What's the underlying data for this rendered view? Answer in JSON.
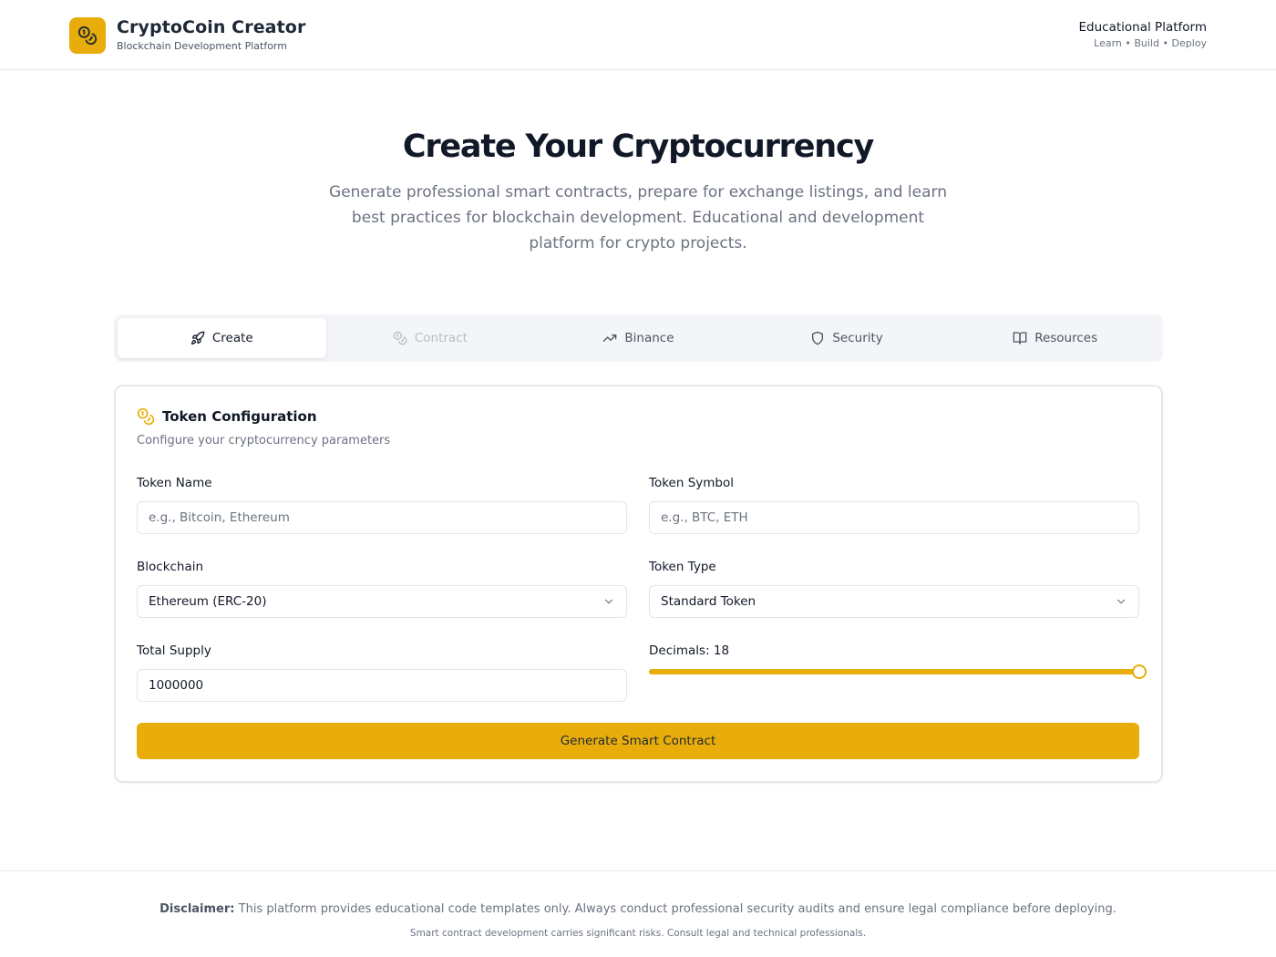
{
  "header": {
    "brand_title": "CryptoCoin Creator",
    "brand_subtitle": "Blockchain Development Platform",
    "right_title": "Educational Platform",
    "right_subtitle": "Learn • Build • Deploy",
    "logo_icon": "coins-icon",
    "accent_color": "#e8ad0a"
  },
  "hero": {
    "title": "Create Your Cryptocurrency",
    "description": "Generate professional smart contracts, prepare for exchange listings, and learn best practices for blockchain development. Educational and development platform for crypto projects."
  },
  "tabs": [
    {
      "label": "Create",
      "icon": "rocket-icon",
      "state": "active"
    },
    {
      "label": "Contract",
      "icon": "coins-icon",
      "state": "disabled"
    },
    {
      "label": "Binance",
      "icon": "trending-up-icon",
      "state": "normal"
    },
    {
      "label": "Security",
      "icon": "shield-icon",
      "state": "normal"
    },
    {
      "label": "Resources",
      "icon": "book-open-icon",
      "state": "normal"
    }
  ],
  "card": {
    "title": "Token Configuration",
    "subtitle": "Configure your cryptocurrency parameters",
    "icon": "coins-icon"
  },
  "form": {
    "token_name": {
      "label": "Token Name",
      "value": "",
      "placeholder": "e.g., Bitcoin, Ethereum"
    },
    "token_symbol": {
      "label": "Token Symbol",
      "value": "",
      "placeholder": "e.g., BTC, ETH"
    },
    "blockchain": {
      "label": "Blockchain",
      "selected": "Ethereum (ERC-20)"
    },
    "token_type": {
      "label": "Token Type",
      "selected": "Standard Token"
    },
    "total_supply": {
      "label": "Total Supply",
      "value": "1000000"
    },
    "decimals": {
      "label": "Decimals: 18",
      "value": 18,
      "min": 0,
      "max": 18
    }
  },
  "actions": {
    "generate_label": "Generate Smart Contract"
  },
  "footer": {
    "disclaimer_bold": "Disclaimer:",
    "disclaimer_text": " This platform provides educational code templates only. Always conduct professional security audits and ensure legal compliance before deploying.",
    "footnote": "Smart contract development carries significant risks. Consult legal and technical professionals."
  }
}
